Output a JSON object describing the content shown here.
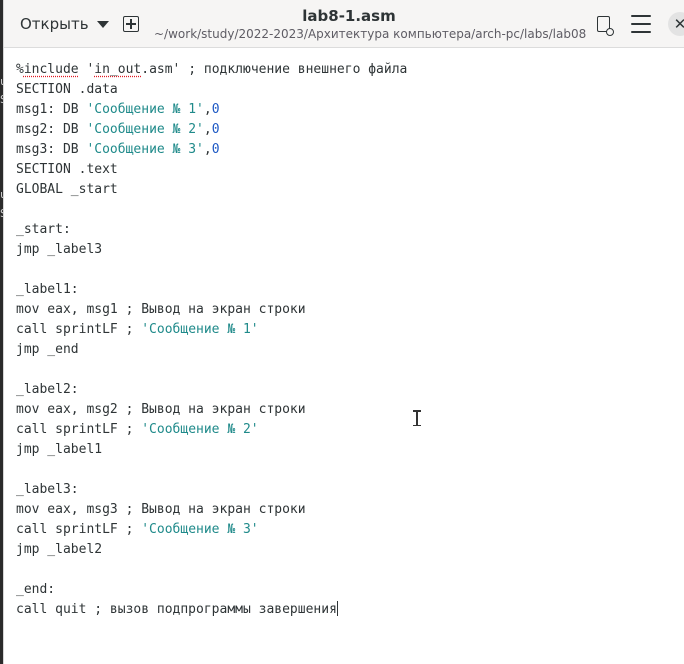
{
  "header": {
    "open_label": "Открыть",
    "title": "lab8-1.asm",
    "path": "~/work/study/2022-2023/Архитектура компьютера/arch-pc/labs/lab08",
    "close_glyph": "✕"
  },
  "background_fragments": [
    "u",
    "S",
    "u",
    "S"
  ],
  "code": {
    "lines": [
      [
        {
          "t": "%"
        },
        {
          "t": "include",
          "c": "spell"
        },
        {
          "t": " '"
        },
        {
          "t": "in_out",
          "c": "spell"
        },
        {
          "t": ".asm' ; подключение внешнего файла"
        }
      ],
      [
        {
          "t": "SECTION .data"
        }
      ],
      [
        {
          "t": "msg1: DB "
        },
        {
          "t": "'Сообщение № 1'",
          "c": "str"
        },
        {
          "t": ","
        },
        {
          "t": "0",
          "c": "num"
        }
      ],
      [
        {
          "t": "msg2: DB "
        },
        {
          "t": "'Сообщение № 2'",
          "c": "str"
        },
        {
          "t": ","
        },
        {
          "t": "0",
          "c": "num"
        }
      ],
      [
        {
          "t": "msg3: DB "
        },
        {
          "t": "'Сообщение № 3'",
          "c": "str"
        },
        {
          "t": ","
        },
        {
          "t": "0",
          "c": "num"
        }
      ],
      [
        {
          "t": "SECTION .text"
        }
      ],
      [
        {
          "t": "GLOBAL _start"
        }
      ],
      [],
      [
        {
          "t": "_start:"
        }
      ],
      [
        {
          "t": "jmp _label3"
        }
      ],
      [],
      [
        {
          "t": "_label1:"
        }
      ],
      [
        {
          "t": "mov eax, msg1 ; Вывод на экран строки"
        }
      ],
      [
        {
          "t": "call sprintLF ; "
        },
        {
          "t": "'Сообщение № 1'",
          "c": "str"
        }
      ],
      [
        {
          "t": "jmp _end"
        }
      ],
      [],
      [
        {
          "t": "_label2:"
        }
      ],
      [
        {
          "t": "mov eax, msg2 ; Вывод на экран строки"
        }
      ],
      [
        {
          "t": "call sprintLF ; "
        },
        {
          "t": "'Сообщение № 2'",
          "c": "str"
        }
      ],
      [
        {
          "t": "jmp _label1"
        }
      ],
      [],
      [
        {
          "t": "_label3:"
        }
      ],
      [
        {
          "t": "mov eax, msg3 ; Вывод на экран строки"
        }
      ],
      [
        {
          "t": "call sprintLF ; "
        },
        {
          "t": "'Сообщение № 3'",
          "c": "str"
        }
      ],
      [
        {
          "t": "jmp _label2"
        }
      ],
      [],
      [
        {
          "t": "_end:"
        }
      ],
      [
        {
          "t": "call quit ; вызов подпрограммы завершения"
        }
      ]
    ]
  },
  "icons": {
    "open_menu": "chevron-down-icon",
    "new_tab": "new-tab-icon",
    "save": "save-document-icon",
    "menu": "hamburger-menu-icon",
    "close": "close-icon"
  }
}
